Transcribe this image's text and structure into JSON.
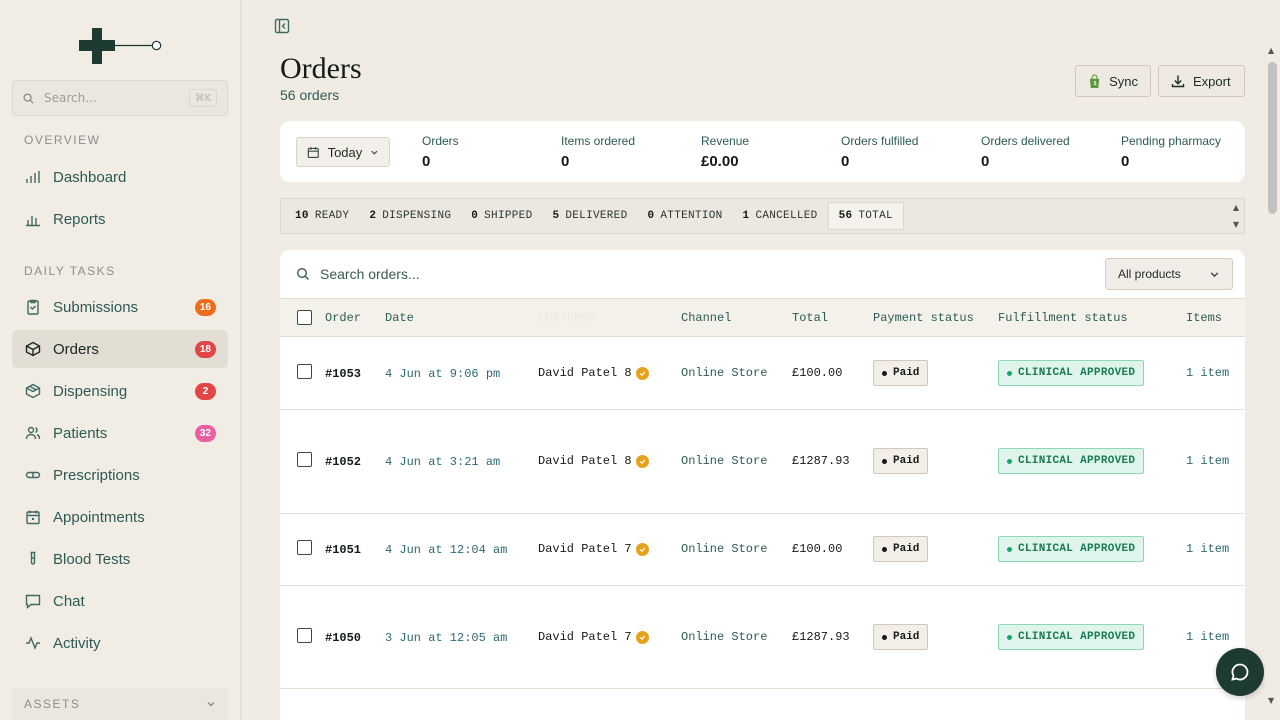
{
  "sidebar": {
    "search_placeholder": "Search...",
    "search_shortcut": "⌘K",
    "overview_label": "OVERVIEW",
    "daily_tasks_label": "DAILY TASKS",
    "assets_label": "ASSETS",
    "items": [
      {
        "label": "Dashboard"
      },
      {
        "label": "Reports"
      },
      {
        "label": "Submissions",
        "badge": "16"
      },
      {
        "label": "Orders",
        "badge": "18"
      },
      {
        "label": "Dispensing",
        "badge": "2"
      },
      {
        "label": "Patients",
        "badge": "32"
      },
      {
        "label": "Prescriptions"
      },
      {
        "label": "Appointments"
      },
      {
        "label": "Blood Tests"
      },
      {
        "label": "Chat"
      },
      {
        "label": "Activity"
      }
    ],
    "badge_colors": {
      "orange": "#ef6c1b",
      "red": "#e24545",
      "pink": "#e85fa3"
    }
  },
  "header": {
    "title": "Orders",
    "subtitle": "56 orders",
    "sync_label": "Sync",
    "export_label": "Export"
  },
  "stats": {
    "range_label": "Today",
    "items": [
      {
        "label": "Orders",
        "value": "0"
      },
      {
        "label": "Items ordered",
        "value": "0"
      },
      {
        "label": "Revenue",
        "value": "£0.00"
      },
      {
        "label": "Orders fulfilled",
        "value": "0"
      },
      {
        "label": "Orders delivered",
        "value": "0"
      },
      {
        "label": "Pending pharmacy",
        "value": "0"
      }
    ]
  },
  "status_filters": [
    {
      "count": "10",
      "label": "READY"
    },
    {
      "count": "2",
      "label": "DISPENSING"
    },
    {
      "count": "0",
      "label": "SHIPPED"
    },
    {
      "count": "5",
      "label": "DELIVERED"
    },
    {
      "count": "0",
      "label": "ATTENTION"
    },
    {
      "count": "1",
      "label": "CANCELLED"
    },
    {
      "count": "56",
      "label": "TOTAL"
    }
  ],
  "table": {
    "search_placeholder": "Search orders...",
    "product_filter": "All products",
    "columns": [
      "Order",
      "Date",
      "CUSTOMER",
      "Channel",
      "Total",
      "Payment status",
      "Fulfillment status",
      "Items"
    ],
    "rows": [
      {
        "order": "#1053",
        "date": "4 Jun at 9:06 pm",
        "customer": "David Patel 8",
        "channel": "Online Store",
        "total": "£100.00",
        "payment": "Paid",
        "fulfillment": "CLINICAL APPROVED",
        "items": "1 item"
      },
      {
        "order": "#1052",
        "date": "4 Jun at 3:21 am",
        "customer": "David Patel 8",
        "channel": "Online Store",
        "total": "£1287.93",
        "payment": "Paid",
        "fulfillment": "CLINICAL APPROVED",
        "items": "1 item"
      },
      {
        "order": "#1051",
        "date": "4 Jun at 12:04 am",
        "customer": "David Patel 7",
        "channel": "Online Store",
        "total": "£100.00",
        "payment": "Paid",
        "fulfillment": "CLINICAL APPROVED",
        "items": "1 item"
      },
      {
        "order": "#1050",
        "date": "3 Jun at 12:05 am",
        "customer": "David Patel 7",
        "channel": "Online Store",
        "total": "£1287.93",
        "payment": "Paid",
        "fulfillment": "CLINICAL APPROVED",
        "items": "1 item"
      }
    ]
  },
  "colors": {
    "accent_dark": "#1d3b33",
    "approved_green": "#1a7a55",
    "verified_orange": "#e7a21b"
  }
}
